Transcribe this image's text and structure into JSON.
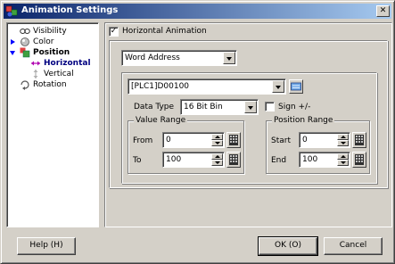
{
  "window": {
    "title": "Animation Settings",
    "close_glyph": "✕"
  },
  "tree": {
    "items": [
      {
        "label": "Visibility",
        "icon": "visibility-icon"
      },
      {
        "label": "Color",
        "icon": "color-icon"
      },
      {
        "label": "Position",
        "icon": "position-icon"
      },
      {
        "label": "Horizontal",
        "icon": "horizontal-arrow-icon"
      },
      {
        "label": "Vertical",
        "icon": "vertical-arrow-icon"
      },
      {
        "label": "Rotation",
        "icon": "rotation-icon"
      }
    ],
    "selected": "Horizontal"
  },
  "panel": {
    "horizontal_animation": {
      "label": "Horizontal Animation",
      "checked": true,
      "mark": "✓"
    },
    "address_type": {
      "value": "Word Address"
    },
    "address": {
      "value": "[PLC1]D00100"
    },
    "data_type": {
      "label": "Data Type",
      "value": "16 Bit Bin"
    },
    "sign": {
      "label": "Sign +/-",
      "checked": false,
      "mark": ""
    },
    "value_range": {
      "title": "Value Range",
      "from_label": "From",
      "from_value": "0",
      "to_label": "To",
      "to_value": "100"
    },
    "position_range": {
      "title": "Position Range",
      "start_label": "Start",
      "start_value": "0",
      "end_label": "End",
      "end_value": "100"
    }
  },
  "buttons": {
    "help": "Help (H)",
    "ok": "OK (O)",
    "cancel": "Cancel"
  },
  "colors": {
    "title_bar": "#0a246a",
    "dialog_face": "#d4d0c8",
    "selection_text": "#000080"
  }
}
